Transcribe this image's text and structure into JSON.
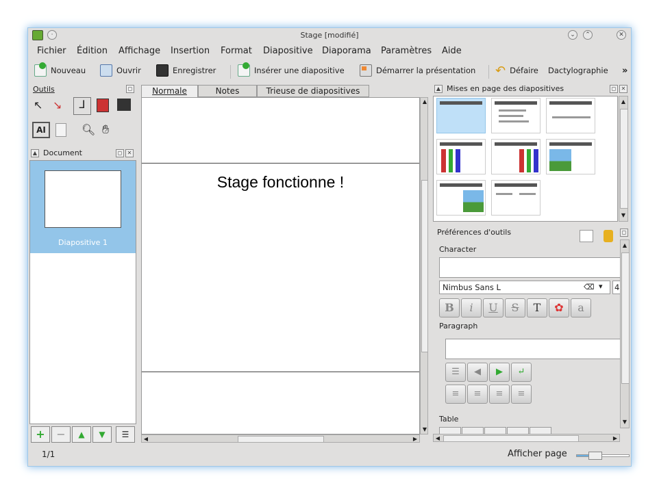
{
  "window": {
    "title": "Stage [modifié]"
  },
  "menu": [
    "Fichier",
    "Édition",
    "Affichage",
    "Insertion",
    "Format",
    "Diapositive",
    "Diaporama",
    "Paramètres",
    "Aide"
  ],
  "toolbar": {
    "new": "Nouveau",
    "open": "Ouvrir",
    "save": "Enregistrer",
    "insert_slide": "Insérer une diapositive",
    "start_presentation": "Démarrer la présentation",
    "undo": "Défaire",
    "undo_detail": "Dactylographie",
    "overflow": "»"
  },
  "tools_panel": {
    "title": "Outils"
  },
  "document_panel": {
    "title": "Document",
    "slides": [
      "Diapositive 1"
    ]
  },
  "tabs": [
    "Normale",
    "Notes",
    "Trieuse de diapositives"
  ],
  "slide": {
    "text": "Stage fonctionne !"
  },
  "layouts_panel": {
    "title": "Mises en page des diapositives"
  },
  "tool_prefs": {
    "title": "Préférences d'outils",
    "character_label": "Character",
    "font_name": "Nimbus Sans L",
    "font_size_partial": "4",
    "paragraph_label": "Paragraph",
    "table_label": "Table"
  },
  "status": {
    "page": "1/1",
    "view_page": "Afficher page"
  },
  "colors": {
    "accent": "#93c5e9",
    "window_border": "#9ec7e8"
  }
}
